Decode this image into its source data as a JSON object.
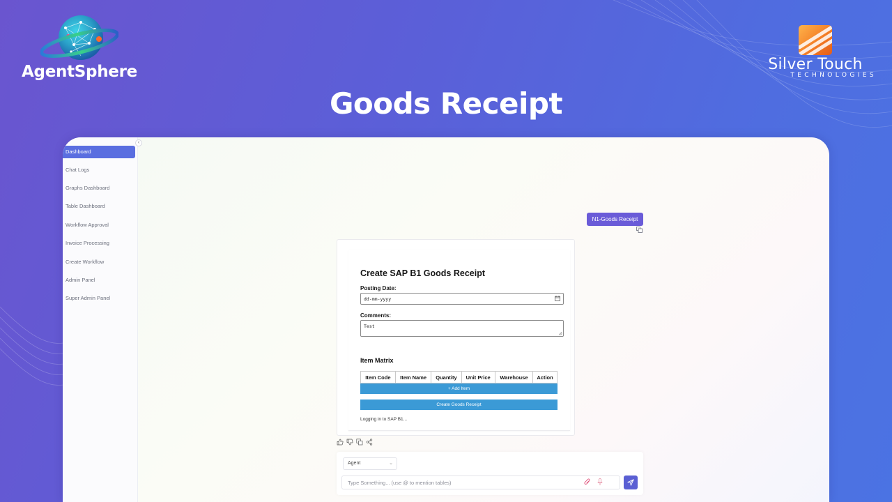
{
  "brand_left": {
    "name": "AgentSphere"
  },
  "brand_right": {
    "name": "Silver Touch",
    "tagline": "TECHNOLOGIES"
  },
  "page_title": "Goods Receipt",
  "sidebar": {
    "collapse_icon": "chevron-left-icon",
    "items": [
      {
        "label": "Dashboard",
        "active": true
      },
      {
        "label": "Chat Logs",
        "active": false
      },
      {
        "label": "Graphs Dashboard",
        "active": false
      },
      {
        "label": "Table Dashboard",
        "active": false
      },
      {
        "label": "Workflow Approval",
        "active": false
      },
      {
        "label": "Invoice Processing",
        "active": false
      },
      {
        "label": "Create Workflow",
        "active": false
      },
      {
        "label": "Admin Panel",
        "active": false
      },
      {
        "label": "Super Admin Panel",
        "active": false
      }
    ]
  },
  "user_message": "N1-Goods Receipt",
  "form": {
    "title": "Create SAP B1 Goods Receipt",
    "posting_date_label": "Posting Date:",
    "posting_date_value": "dd-mm-yyyy",
    "comments_label": "Comments:",
    "comments_value": "Test",
    "matrix_title": "Item Matrix",
    "columns": [
      "Item Code",
      "Item Name",
      "Quantity",
      "Unit Price",
      "Warehouse",
      "Action"
    ],
    "add_item_label": "+ Add Item",
    "submit_label": "Create Goods Receipt",
    "status": "Logging in to SAP B1..."
  },
  "composer": {
    "agent_select": "Agent",
    "input_placeholder": "Type Something... (use @ to mention tables)"
  },
  "colors": {
    "accent": "#5a6ee0",
    "chip": "#6a5bd8",
    "button_blue": "#3b9ad6",
    "send": "#5a5fd3"
  }
}
